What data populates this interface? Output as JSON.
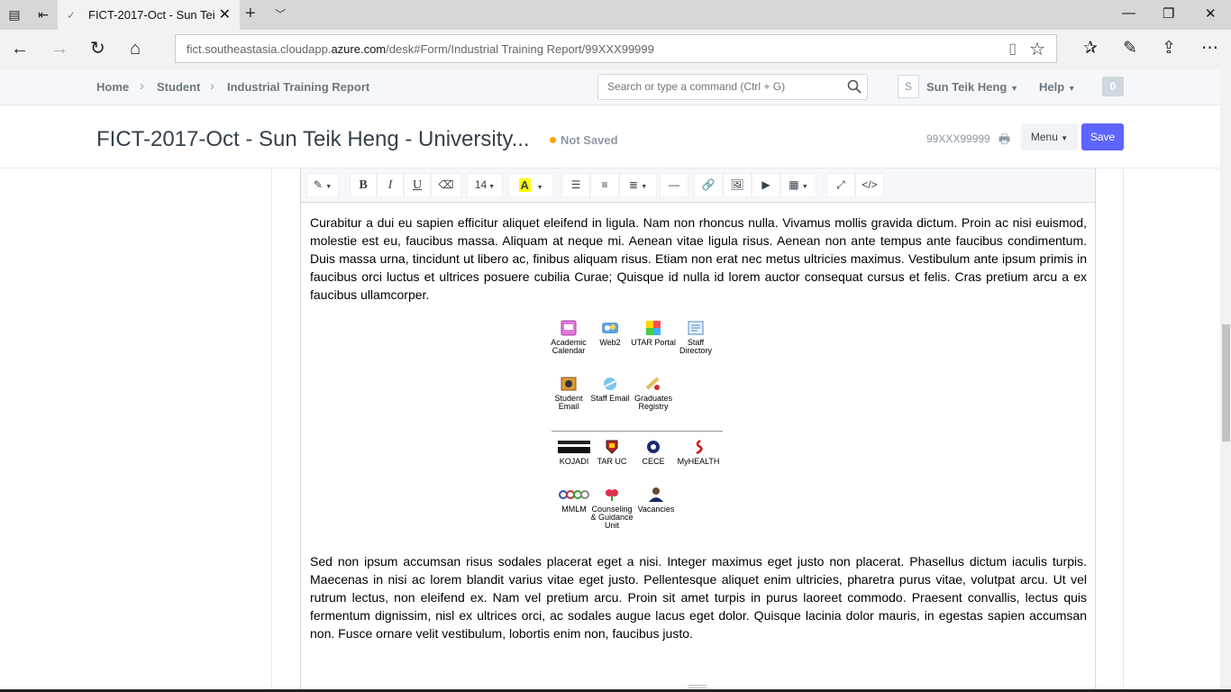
{
  "browser": {
    "tab_title": "FICT-2017-Oct - Sun Tei",
    "url_prefix": "fict.southeastasia.cloudapp.",
    "url_domain": "azure.com",
    "url_path": "/desk#Form/Industrial Training Report/99XXX99999"
  },
  "nav": {
    "breadcrumbs": [
      "Home",
      "Student",
      "Industrial Training Report"
    ],
    "search_placeholder": "Search or type a command (Ctrl + G)",
    "avatar_letter": "S",
    "user_name": "Sun Teik Heng",
    "help_label": "Help",
    "notification_count": "0"
  },
  "page": {
    "title": "FICT-2017-Oct - Sun Teik Heng - University...",
    "status": "Not Saved",
    "doc_id": "99XXX99999",
    "menu_label": "Menu",
    "save_label": "Save"
  },
  "editor": {
    "font_size": "14",
    "paragraph1": "Curabitur a dui eu sapien efficitur aliquet eleifend in ligula. Nam non rhoncus nulla. Vivamus mollis gravida dictum. Proin ac nisi euismod, molestie est eu, faucibus massa. Aliquam at neque mi. Aenean vitae ligula risus. Aenean non ante tempus ante faucibus condimentum. Duis massa urna, tincidunt ut libero ac, finibus aliquam risus. Etiam non erat nec metus ultricies maximus. Vestibulum ante ipsum primis in faucibus orci luctus et ultrices posuere cubilia Curae; Quisque id nulla id lorem auctor consequat cursus et felis. Cras pretium arcu a ex faucibus ullamcorper.",
    "paragraph2": "Sed non ipsum accumsan risus sodales placerat eget a nisi. Integer maximus eget justo non placerat. Phasellus dictum iaculis turpis. Maecenas in nisi ac lorem blandit varius vitae eget justo. Pellentesque aliquet enim ultricies, pharetra purus vitae, volutpat arcu. Ut vel rutrum lectus, non eleifend ex. Nam vel pretium arcu. Proin sit amet turpis in purus laoreet commodo. Praesent convallis, lectus quis fermentum dignissim, nisl ex ultrices orci, ac sodales augue lacus eget dolor. Quisque lacinia dolor mauris, in egestas sapien accumsan non. Fusce ornare velit vestibulum, lobortis enim non, faucibus justo.",
    "image_labels": {
      "academic_calendar": "Academic Calendar",
      "web2": "Web2",
      "utar_portal": "UTAR Portal",
      "staff_directory": "Staff Directory",
      "student_email": "Student Email",
      "staff_email": "Staff Email",
      "graduates_registry": "Graduates Registry",
      "kojadi": "KOJADI",
      "tar_uc": "TAR UC",
      "cece": "CECE",
      "myhealth": "MyHEALTH",
      "mmlm": "MMLM",
      "counseling": "Counseling & Guidance Unit",
      "vacancies": "Vacancies"
    }
  },
  "colors": {
    "primary": "#5e64ff",
    "not_saved_dot": "#ffa00a",
    "text_muted": "#6c7680"
  }
}
